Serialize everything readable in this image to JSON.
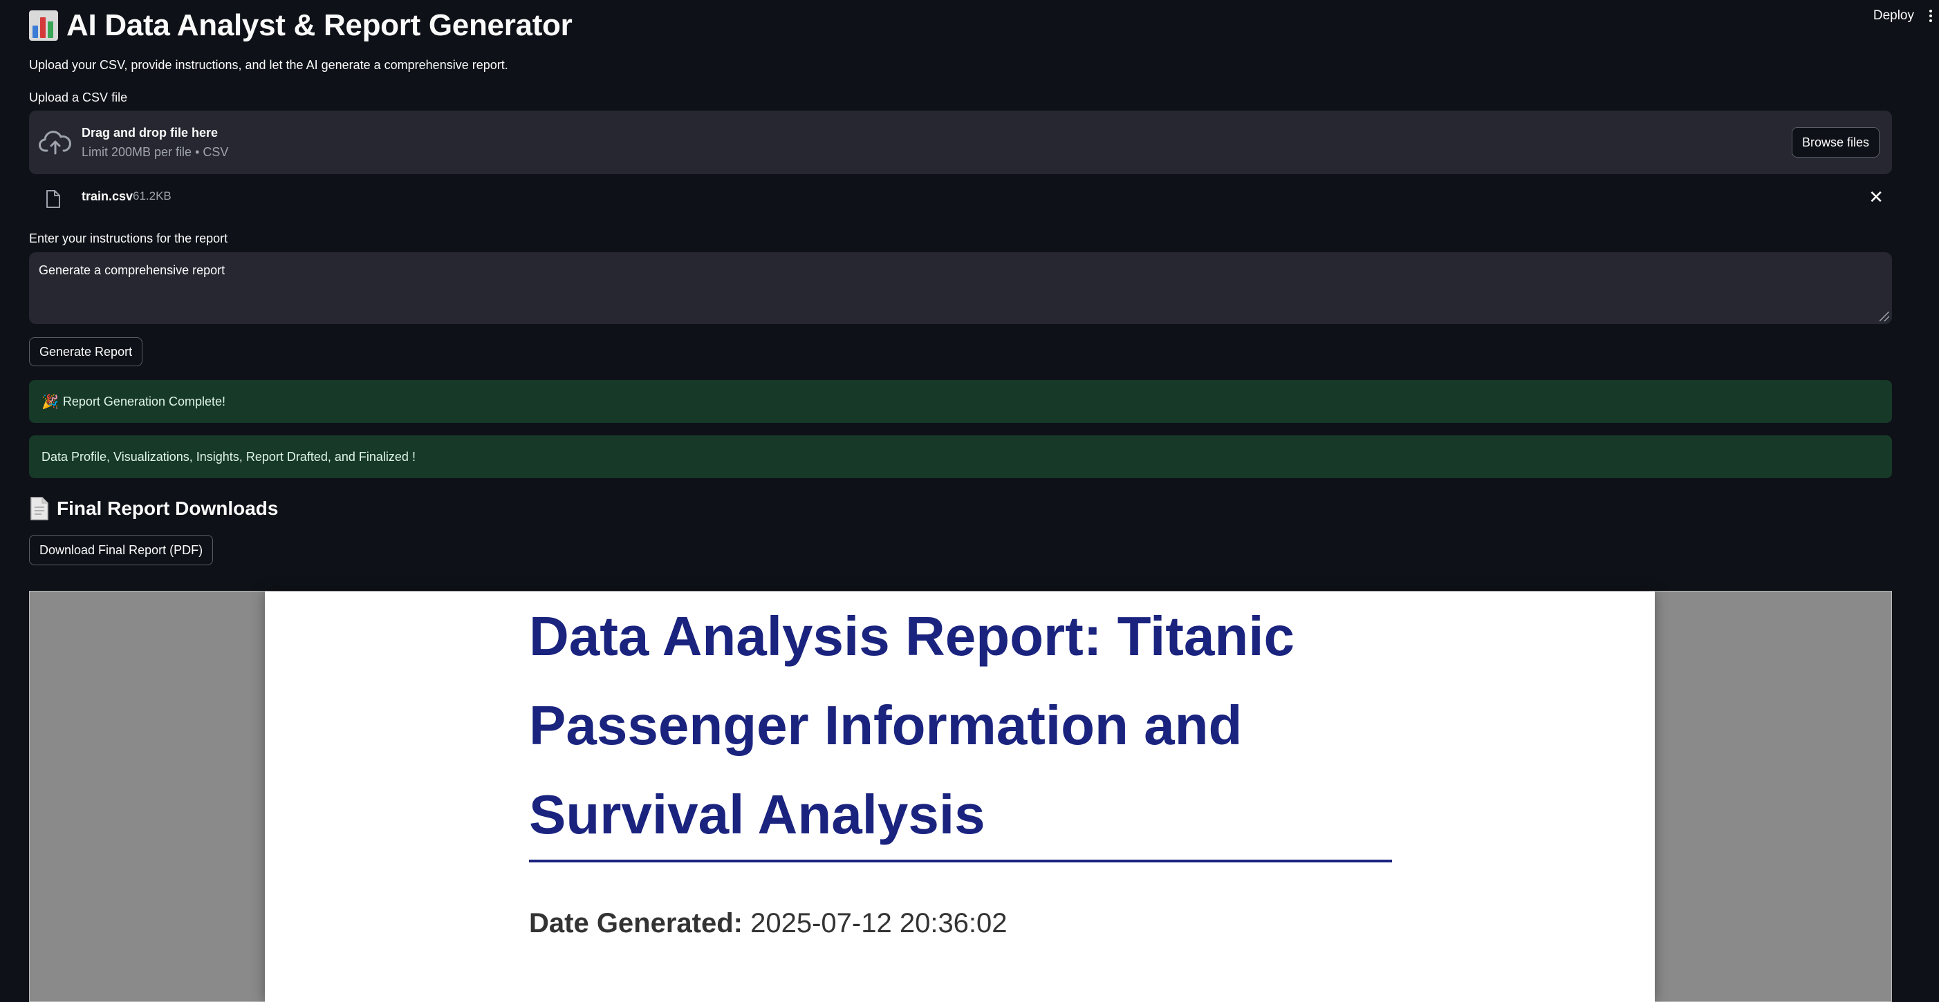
{
  "header": {
    "deploy_label": "Deploy",
    "app_title": "AI Data Analyst & Report Generator",
    "subtitle": "Upload your CSV, provide instructions, and let the AI generate a comprehensive report."
  },
  "uploader": {
    "label": "Upload a CSV file",
    "drop_text": "Drag and drop file here",
    "limit_text": "Limit 200MB per file • CSV",
    "browse_label": "Browse files",
    "file": {
      "name": "train.csv",
      "size": "61.2KB"
    }
  },
  "instructions": {
    "label": "Enter your instructions for the report",
    "value": "Generate a comprehensive report"
  },
  "actions": {
    "generate_label": "Generate Report"
  },
  "alerts": {
    "complete": "Report Generation Complete!",
    "steps": "Data Profile, Visualizations, Insights, Report Drafted, and Finalized !"
  },
  "downloads": {
    "heading": "Final Report Downloads",
    "pdf_button": "Download Final Report (PDF)"
  },
  "pdf_preview": {
    "title_lines": [
      "Data Analysis Report: Titanic",
      "Passenger Information and",
      "Survival Analysis"
    ],
    "date_label": "Date Generated:",
    "date_value": "2025-07-12 20:36:02"
  },
  "colors": {
    "background": "#0e1117",
    "panel": "#262730",
    "success_bg": "#173928",
    "report_title": "#1a237e"
  },
  "icons": [
    "bar-chart-icon",
    "cloud-upload-icon",
    "file-icon",
    "close-icon",
    "party-popper-icon",
    "document-icon",
    "kebab-menu-icon"
  ]
}
